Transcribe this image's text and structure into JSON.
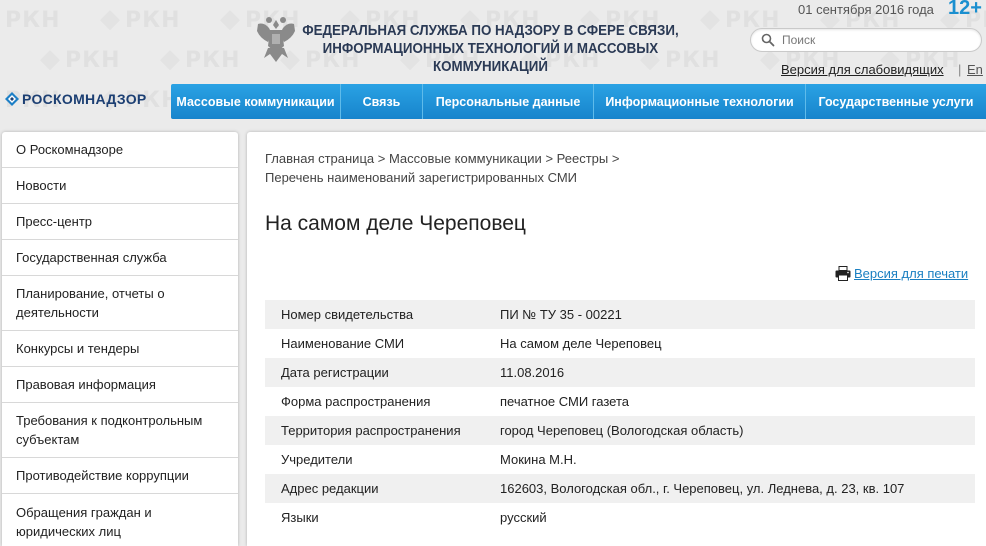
{
  "header": {
    "agency_title": "ФЕДЕРАЛЬНАЯ СЛУЖБА ПО НАДЗОРУ В СФЕРЕ СВЯЗИ,\nИНФОРМАЦИОННЫХ ТЕХНОЛОГИЙ И МАССОВЫХ КОММУНИКАЦИЙ",
    "date": "01 сентября 2016 года",
    "age_rating": "12+",
    "search_placeholder": "Поиск",
    "accessible_version": "Версия для слабовидящих",
    "separator": "|",
    "lang": "En",
    "logo_text": "РОСКОМНАДЗОР",
    "watermark_text": "РКН"
  },
  "nav": {
    "items": [
      {
        "label": "Массовые коммуникации"
      },
      {
        "label": "Связь"
      },
      {
        "label": "Персональные данные"
      },
      {
        "label": "Информационные технологии"
      },
      {
        "label": "Государственные услуги"
      }
    ]
  },
  "sidebar": {
    "items": [
      {
        "label": "О Роскомнадзоре"
      },
      {
        "label": "Новости"
      },
      {
        "label": "Пресс-центр"
      },
      {
        "label": "Государственная служба"
      },
      {
        "label": "Планирование, отчеты о деятельности"
      },
      {
        "label": "Конкурсы и тендеры"
      },
      {
        "label": "Правовая информация"
      },
      {
        "label": "Требования к подконтрольным субъектам"
      },
      {
        "label": "Противодействие коррупции"
      },
      {
        "label": "Обращения граждан и юридических лиц"
      }
    ]
  },
  "main": {
    "breadcrumb": {
      "items": [
        "Главная страница",
        "Массовые коммуникации",
        "Реестры"
      ],
      "separator": " > ",
      "current": "Перечень наименований зарегистрированных СМИ"
    },
    "title": "На самом деле Череповец",
    "print_label": "Версия для печати",
    "table": [
      {
        "key": "Номер свидетельства",
        "value": "ПИ № ТУ 35 - 00221"
      },
      {
        "key": "Наименование СМИ",
        "value": "На самом деле Череповец"
      },
      {
        "key": "Дата регистрации",
        "value": "11.08.2016"
      },
      {
        "key": "Форма распространения",
        "value": "печатное СМИ газета"
      },
      {
        "key": "Территория распространения",
        "value": "город Череповец (Вологодская область)"
      },
      {
        "key": "Учредители",
        "value": "Мокина М.Н."
      },
      {
        "key": "Адрес редакции",
        "value": "162603, Вологодская обл., г. Череповец, ул. Леднева, д. 23, кв. 107"
      },
      {
        "key": "Языки",
        "value": "русский"
      }
    ]
  },
  "colors": {
    "nav_blue": "#1f93d8",
    "title_navy": "#2b3a55",
    "link_blue": "#1a7fc1",
    "age_blue": "#1a8fcf"
  }
}
